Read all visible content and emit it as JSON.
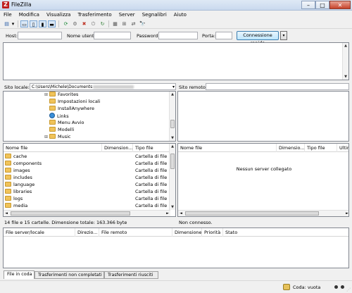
{
  "window": {
    "title": "FileZilla",
    "app_icon": "filezilla-icon",
    "minimize": "–",
    "maximize": "□",
    "close": "✕"
  },
  "menu": [
    "File",
    "Modifica",
    "Visualizza",
    "Trasferimento",
    "Server",
    "Segnalibri",
    "Aiuto"
  ],
  "toolbar": {
    "icons": [
      "site-manager-icon",
      "dropdown-icon",
      "toggle-log-icon",
      "toggle-local-tree-icon",
      "toggle-remote-tree-icon",
      "toggle-queue-icon",
      "refresh-icon",
      "process-queue-icon",
      "cancel-icon",
      "disconnect-icon",
      "reconnect-icon",
      "filter-icon",
      "compare-icon",
      "sync-browse-icon",
      "find-icon"
    ],
    "glyphs": [
      "▤",
      "▾",
      "▭",
      "▯",
      "▮",
      "▬",
      "⟳",
      "⚙",
      "✖",
      "⏻",
      "↻",
      "▦",
      "⊞",
      "⇄",
      "🔭"
    ]
  },
  "quickconnect": {
    "host_label": "Host:",
    "host_value": "",
    "user_label": "Nome utente:",
    "user_value": "",
    "password_label": "Password:",
    "password_value": "",
    "port_label": "Porta:",
    "port_value": "",
    "connect_button": "Connessione rapida",
    "dropdown": "▾"
  },
  "local_site": {
    "label": "Sito locale:",
    "path": "C:\\Users\\Michele\\Documents"
  },
  "remote_site": {
    "label": "Sito remoto:",
    "path": ""
  },
  "local_tree": [
    {
      "name": "Favorites",
      "expander": "⊞",
      "icon": "folder"
    },
    {
      "name": "Impostazioni locali",
      "expander": "",
      "icon": "folder"
    },
    {
      "name": "InstallAnywhere",
      "expander": "",
      "icon": "folder"
    },
    {
      "name": "Links",
      "expander": "",
      "icon": "links"
    },
    {
      "name": "Menu Avvio",
      "expander": "",
      "icon": "folder"
    },
    {
      "name": "Modelli",
      "expander": "",
      "icon": "folder"
    },
    {
      "name": "Music",
      "expander": "⊞",
      "icon": "folder"
    }
  ],
  "local_files": {
    "columns": [
      "Nome file",
      "Dimension...",
      "Tipo file"
    ],
    "rows": [
      {
        "name": "cache",
        "type": "Cartella di file"
      },
      {
        "name": "components",
        "type": "Cartella di file"
      },
      {
        "name": "images",
        "type": "Cartella di file"
      },
      {
        "name": "includes",
        "type": "Cartella di file"
      },
      {
        "name": "language",
        "type": "Cartella di file"
      },
      {
        "name": "libraries",
        "type": "Cartella di file"
      },
      {
        "name": "logs",
        "type": "Cartella di file"
      },
      {
        "name": "media",
        "type": "Cartella di file"
      }
    ],
    "status": "14 file e 15 cartelle. Dimensione totale: 163.366 byte"
  },
  "remote_files": {
    "columns": [
      "Nome file",
      "Dimensio...",
      "Tipo file",
      "Ultim"
    ],
    "empty_message": "Nessun server collegato",
    "status": "Non connesso."
  },
  "queue": {
    "columns": [
      "File server/locale",
      "Direzio...",
      "File remoto",
      "Dimensione",
      "Priorità",
      "Stato"
    ]
  },
  "tabs": [
    "File in coda",
    "Trasferimenti non completati",
    "Trasferimenti riusciti"
  ],
  "statusbar": {
    "queue_label": "Coda: vuota",
    "lock_icon": "queue-icon"
  },
  "scroll_arrows": {
    "up": "▲",
    "down": "▼",
    "left": "◄",
    "right": "►"
  }
}
